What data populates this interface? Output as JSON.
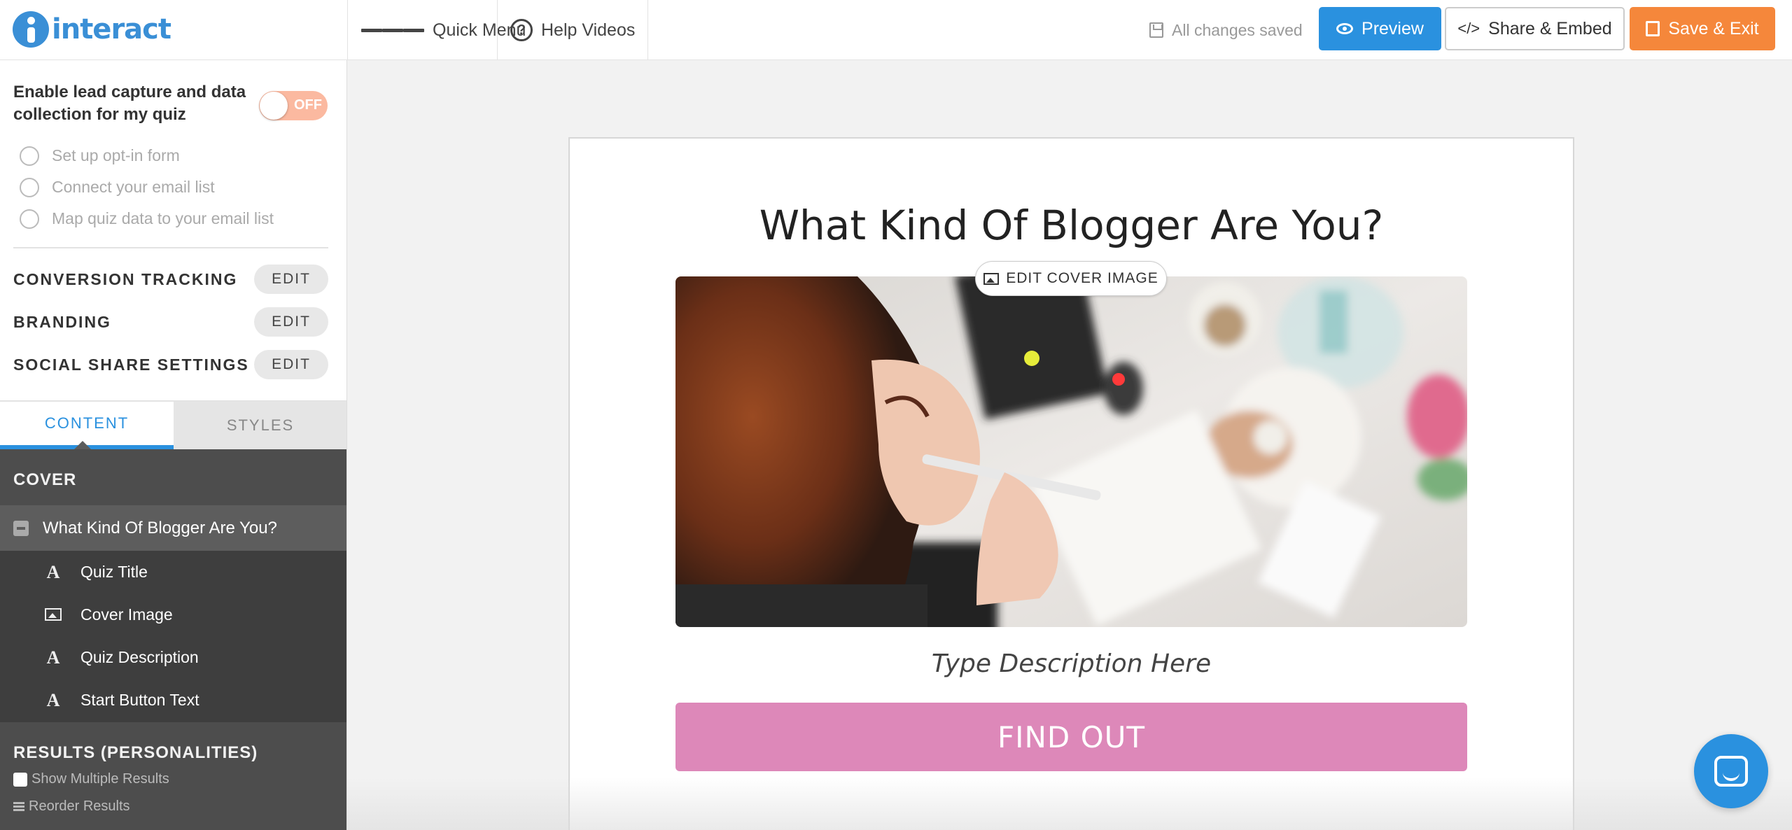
{
  "app": {
    "logo_text": "interact",
    "brand_color": "#3a8fd6"
  },
  "topbar": {
    "quick_menu": "Quick Menu",
    "help_videos": "Help Videos",
    "saved_status": "All changes saved",
    "preview": "Preview",
    "share_embed": "Share & Embed",
    "save_exit": "Save & Exit",
    "preview_color": "#2a91df",
    "save_color": "#f5873b"
  },
  "sidebar": {
    "lead_capture_label": "Enable lead capture and data collection for my quiz",
    "lead_capture_toggle": "OFF",
    "steps": [
      "Set up opt-in form",
      "Connect your email list",
      "Map quiz data to your email list"
    ],
    "settings": [
      {
        "label": "CONVERSION TRACKING",
        "button": "EDIT"
      },
      {
        "label": "BRANDING",
        "button": "EDIT"
      },
      {
        "label": "SOCIAL SHARE SETTINGS",
        "button": "EDIT"
      }
    ],
    "tabs": [
      "CONTENT",
      "STYLES"
    ],
    "active_tab": "CONTENT",
    "cover_heading": "COVER",
    "cover_item": "What Kind Of Blogger Are You?",
    "cover_subitems": [
      {
        "icon": "text-icon",
        "glyph": "A",
        "label": "Quiz Title"
      },
      {
        "icon": "image-icon",
        "glyph": "",
        "label": "Cover Image"
      },
      {
        "icon": "text-icon",
        "glyph": "A",
        "label": "Quiz Description"
      },
      {
        "icon": "text-icon",
        "glyph": "A",
        "label": "Start Button Text"
      }
    ],
    "results_heading": "RESULTS (PERSONALITIES)",
    "show_multiple": "Show Multiple Results",
    "reorder": "Reorder Results"
  },
  "quiz": {
    "title": "What Kind Of Blogger Are You?",
    "edit_cover": "EDIT COVER IMAGE",
    "description_placeholder": "Type Description Here",
    "start_button": "FIND OUT",
    "start_button_color": "#dd88b9"
  }
}
